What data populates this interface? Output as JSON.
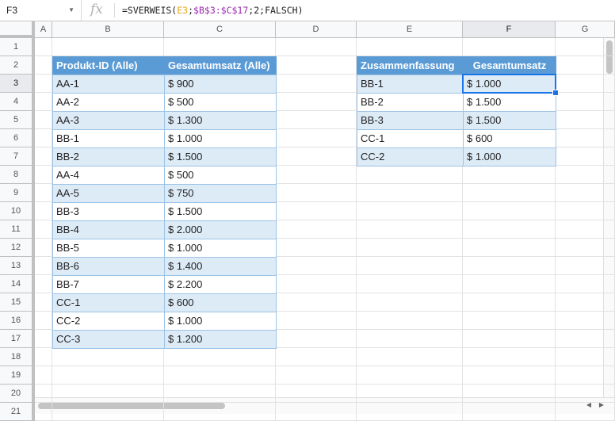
{
  "formula_bar": {
    "cell_ref": "F3",
    "fx": "fx",
    "formula_pre": "=SVERWEIS(",
    "formula_ref1": "E3",
    "formula_sep1": ";",
    "formula_ref2": "$B$3:$C$17",
    "formula_post": ";2;FALSCH)"
  },
  "columns": [
    "A",
    "B",
    "C",
    "D",
    "E",
    "F",
    "G"
  ],
  "rows": [
    "1",
    "2",
    "3",
    "4",
    "5",
    "6",
    "7",
    "8",
    "9",
    "10",
    "11",
    "12",
    "13",
    "14",
    "15",
    "16",
    "17",
    "18",
    "19",
    "20",
    "21"
  ],
  "table_all": {
    "header": [
      "Produkt-ID (Alle)",
      "Gesamtumsatz (Alle)"
    ],
    "rows": [
      [
        "AA-1",
        "$ 900"
      ],
      [
        "AA-2",
        "$ 500"
      ],
      [
        "AA-3",
        "$ 1.300"
      ],
      [
        "BB-1",
        "$ 1.000"
      ],
      [
        "BB-2",
        "$ 1.500"
      ],
      [
        "AA-4",
        "$ 500"
      ],
      [
        "AA-5",
        "$ 750"
      ],
      [
        "BB-3",
        "$ 1.500"
      ],
      [
        "BB-4",
        "$ 2.000"
      ],
      [
        "BB-5",
        "$ 1.000"
      ],
      [
        "BB-6",
        "$ 1.400"
      ],
      [
        "BB-7",
        "$ 2.200"
      ],
      [
        "CC-1",
        "$ 600"
      ],
      [
        "CC-2",
        "$ 1.000"
      ],
      [
        "CC-3",
        "$ 1.200"
      ]
    ]
  },
  "table_summary": {
    "header": [
      "Zusammenfassung",
      "Gesamtumsatz"
    ],
    "rows": [
      [
        "BB-1",
        "$ 1.000"
      ],
      [
        "BB-2",
        "$ 1.500"
      ],
      [
        "BB-3",
        "$ 1.500"
      ],
      [
        "CC-1",
        "$ 600"
      ],
      [
        "CC-2",
        "$ 1.000"
      ]
    ]
  },
  "selection": {
    "cell": "F3"
  }
}
